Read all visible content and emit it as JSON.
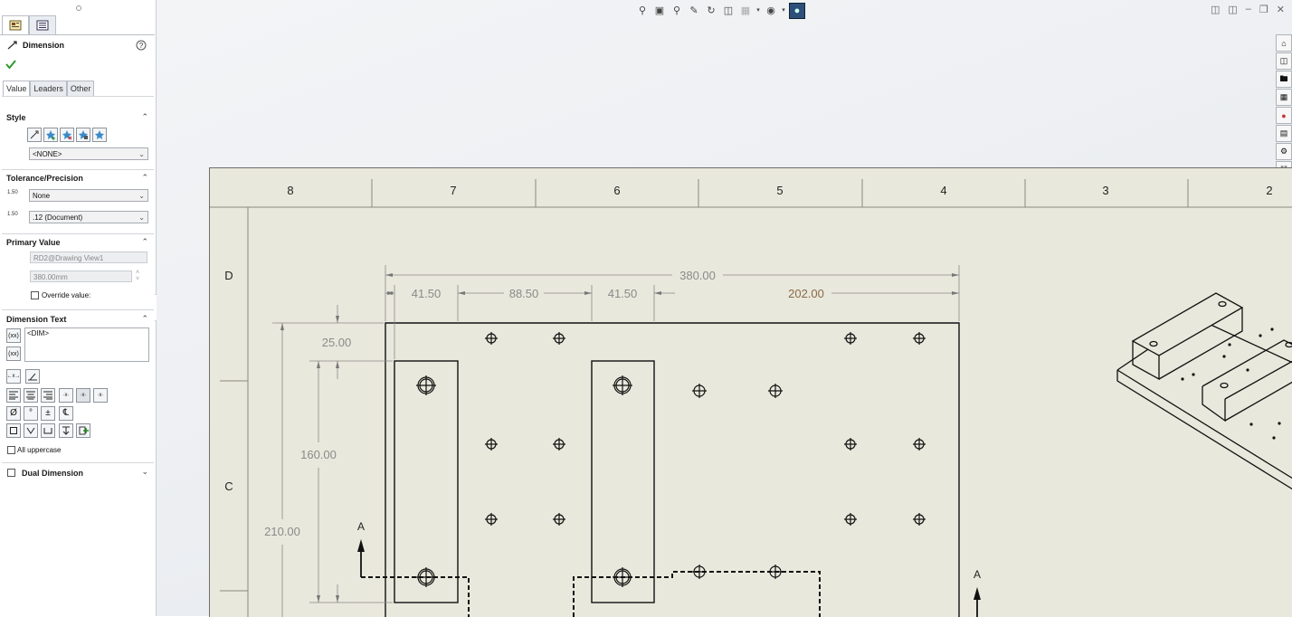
{
  "panel": {
    "title": "Dimension",
    "tabs": [
      "Value",
      "Leaders",
      "Other"
    ],
    "style": {
      "title": "Style",
      "select_value": "<NONE>"
    },
    "tolerance": {
      "title": "Tolerance/Precision",
      "tol_label": "1.50",
      "tolerance_value": "None",
      "prec_label": "1.50",
      "precision_value": ".12 (Document)"
    },
    "primary": {
      "title": "Primary Value",
      "name_value": "RD2@Drawing View1",
      "numeric_value": "380.00mm",
      "override_label": "Override value:"
    },
    "dimtext": {
      "title": "Dimension Text",
      "text": "<DIM>",
      "all_uppercase_label": "All uppercase"
    },
    "dual": {
      "title": "Dual Dimension"
    }
  },
  "drawing": {
    "zone_columns": [
      "8",
      "7",
      "6",
      "5",
      "4",
      "3",
      "2"
    ],
    "zone_rows": [
      "D",
      "C"
    ],
    "dimensions": {
      "overall_width": "380.00",
      "d_41_50_a": "41.50",
      "d_88_50": "88.50",
      "d_41_50_b": "41.50",
      "d_202_00": "202.00",
      "d_25_00": "25.00",
      "d_160_00": "160.00",
      "d_210_00": "210.00"
    },
    "section_label": "A"
  },
  "colors": {
    "sheet": "#e9e8dc",
    "selected_dim": "#8a6a4a",
    "accept": "#2e9a2e"
  }
}
